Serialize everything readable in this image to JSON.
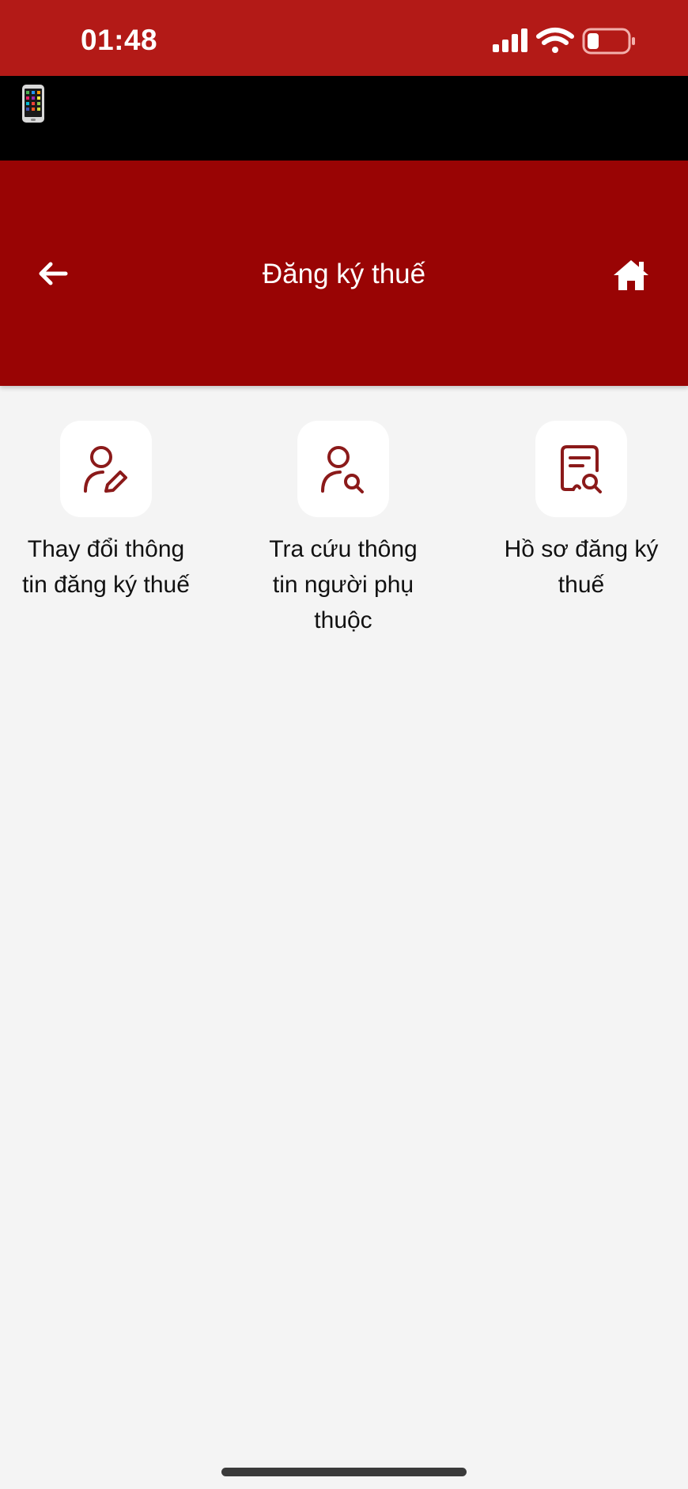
{
  "status_bar": {
    "time": "01:48",
    "icons": [
      "signal-icon",
      "wifi-icon",
      "battery-icon"
    ],
    "battery_color": "#e13a33"
  },
  "app_bar": {
    "icon": "phone-emoji-icon"
  },
  "header": {
    "title": "Đăng ký thuế",
    "back_icon": "arrow-left-icon",
    "home_icon": "home-icon",
    "background": "#990404"
  },
  "tiles": [
    {
      "label": "Thay đổi thông tin đăng ký thuế",
      "icon": "user-edit-icon"
    },
    {
      "label": "Tra cứu thông tin người phụ thuộc",
      "icon": "user-search-icon"
    },
    {
      "label": "Hồ sơ đăng ký thuế",
      "icon": "document-search-icon"
    }
  ],
  "colors": {
    "status_bar": "#b31a17",
    "accent": "#990404",
    "icon_stroke": "#8b1a1a",
    "background": "#f4f4f4"
  }
}
